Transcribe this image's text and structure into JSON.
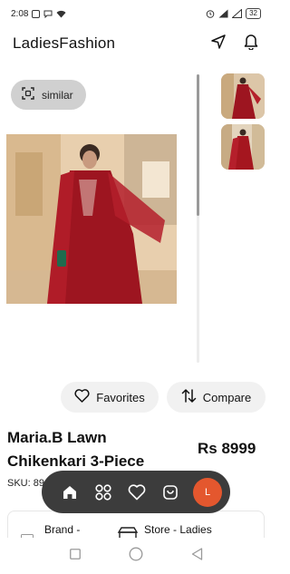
{
  "status": {
    "time": "2:08",
    "battery": "32"
  },
  "app": {
    "title": "LadiesFashion"
  },
  "similar": {
    "label": "similar"
  },
  "actions": {
    "favorites": "Favorites",
    "compare": "Compare"
  },
  "product": {
    "name": "Maria.B Lawn Chikenkari 3-Piece",
    "price": "Rs 8999",
    "sku": "SKU: 89"
  },
  "nav": {
    "avatar_letter": "L",
    "icons": [
      "home-icon",
      "grid-icon",
      "heart-icon",
      "bag-icon"
    ]
  },
  "info": {
    "brand": "Brand -",
    "store": "Store - Ladies"
  },
  "colors": {
    "accent": "#e4572e",
    "nav_bg": "#3c3c3c",
    "chip_bg": "#d0d0d0",
    "button_bg": "#f1f1f1"
  }
}
